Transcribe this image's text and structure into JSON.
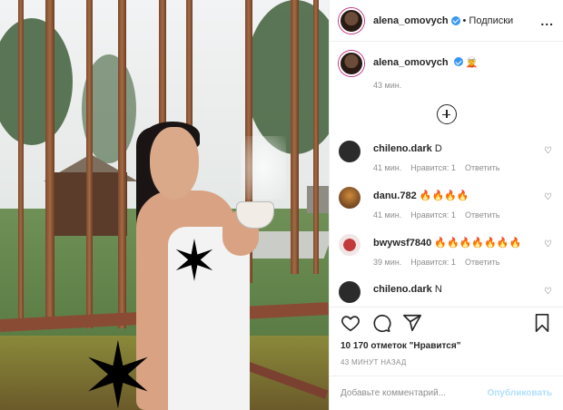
{
  "header": {
    "username": "alena_omovych",
    "separator": "•",
    "follow_label": "Подписки",
    "more_label": "..."
  },
  "caption": {
    "username": "alena_omovych",
    "emoji": "🧝",
    "time": "43 мин."
  },
  "comments": [
    {
      "username": "chileno.dark",
      "text": "D",
      "time": "41 мин.",
      "likes": "Нравится: 1",
      "reply": "Ответить",
      "avatar_color": "#2b2b2b"
    },
    {
      "username": "danu.782",
      "text": "🔥🔥🔥🔥",
      "time": "41 мин.",
      "likes": "Нравится: 1",
      "reply": "Ответить",
      "avatar_color": "#8a5a2a"
    },
    {
      "username": "bwywsf7840",
      "text": "🔥🔥🔥🔥🔥🔥🔥",
      "time": "39 мин.",
      "likes": "Нравится: 1",
      "reply": "Ответить",
      "avatar_color": "#c23b3b"
    },
    {
      "username": "chileno.dark",
      "text": "N",
      "avatar_color": "#2b2b2b"
    }
  ],
  "likes_text": "10 170 отметок \"Нравится\"",
  "post_time": "43 МИНУТ НАЗАД",
  "add_comment": {
    "placeholder": "Добавьте комментарий...",
    "publish_label": "Опубликовать"
  },
  "colors": {
    "verified": "#3897f0",
    "publish_disabled": "#b2dffc",
    "muted_text": "#8e8e8e"
  }
}
